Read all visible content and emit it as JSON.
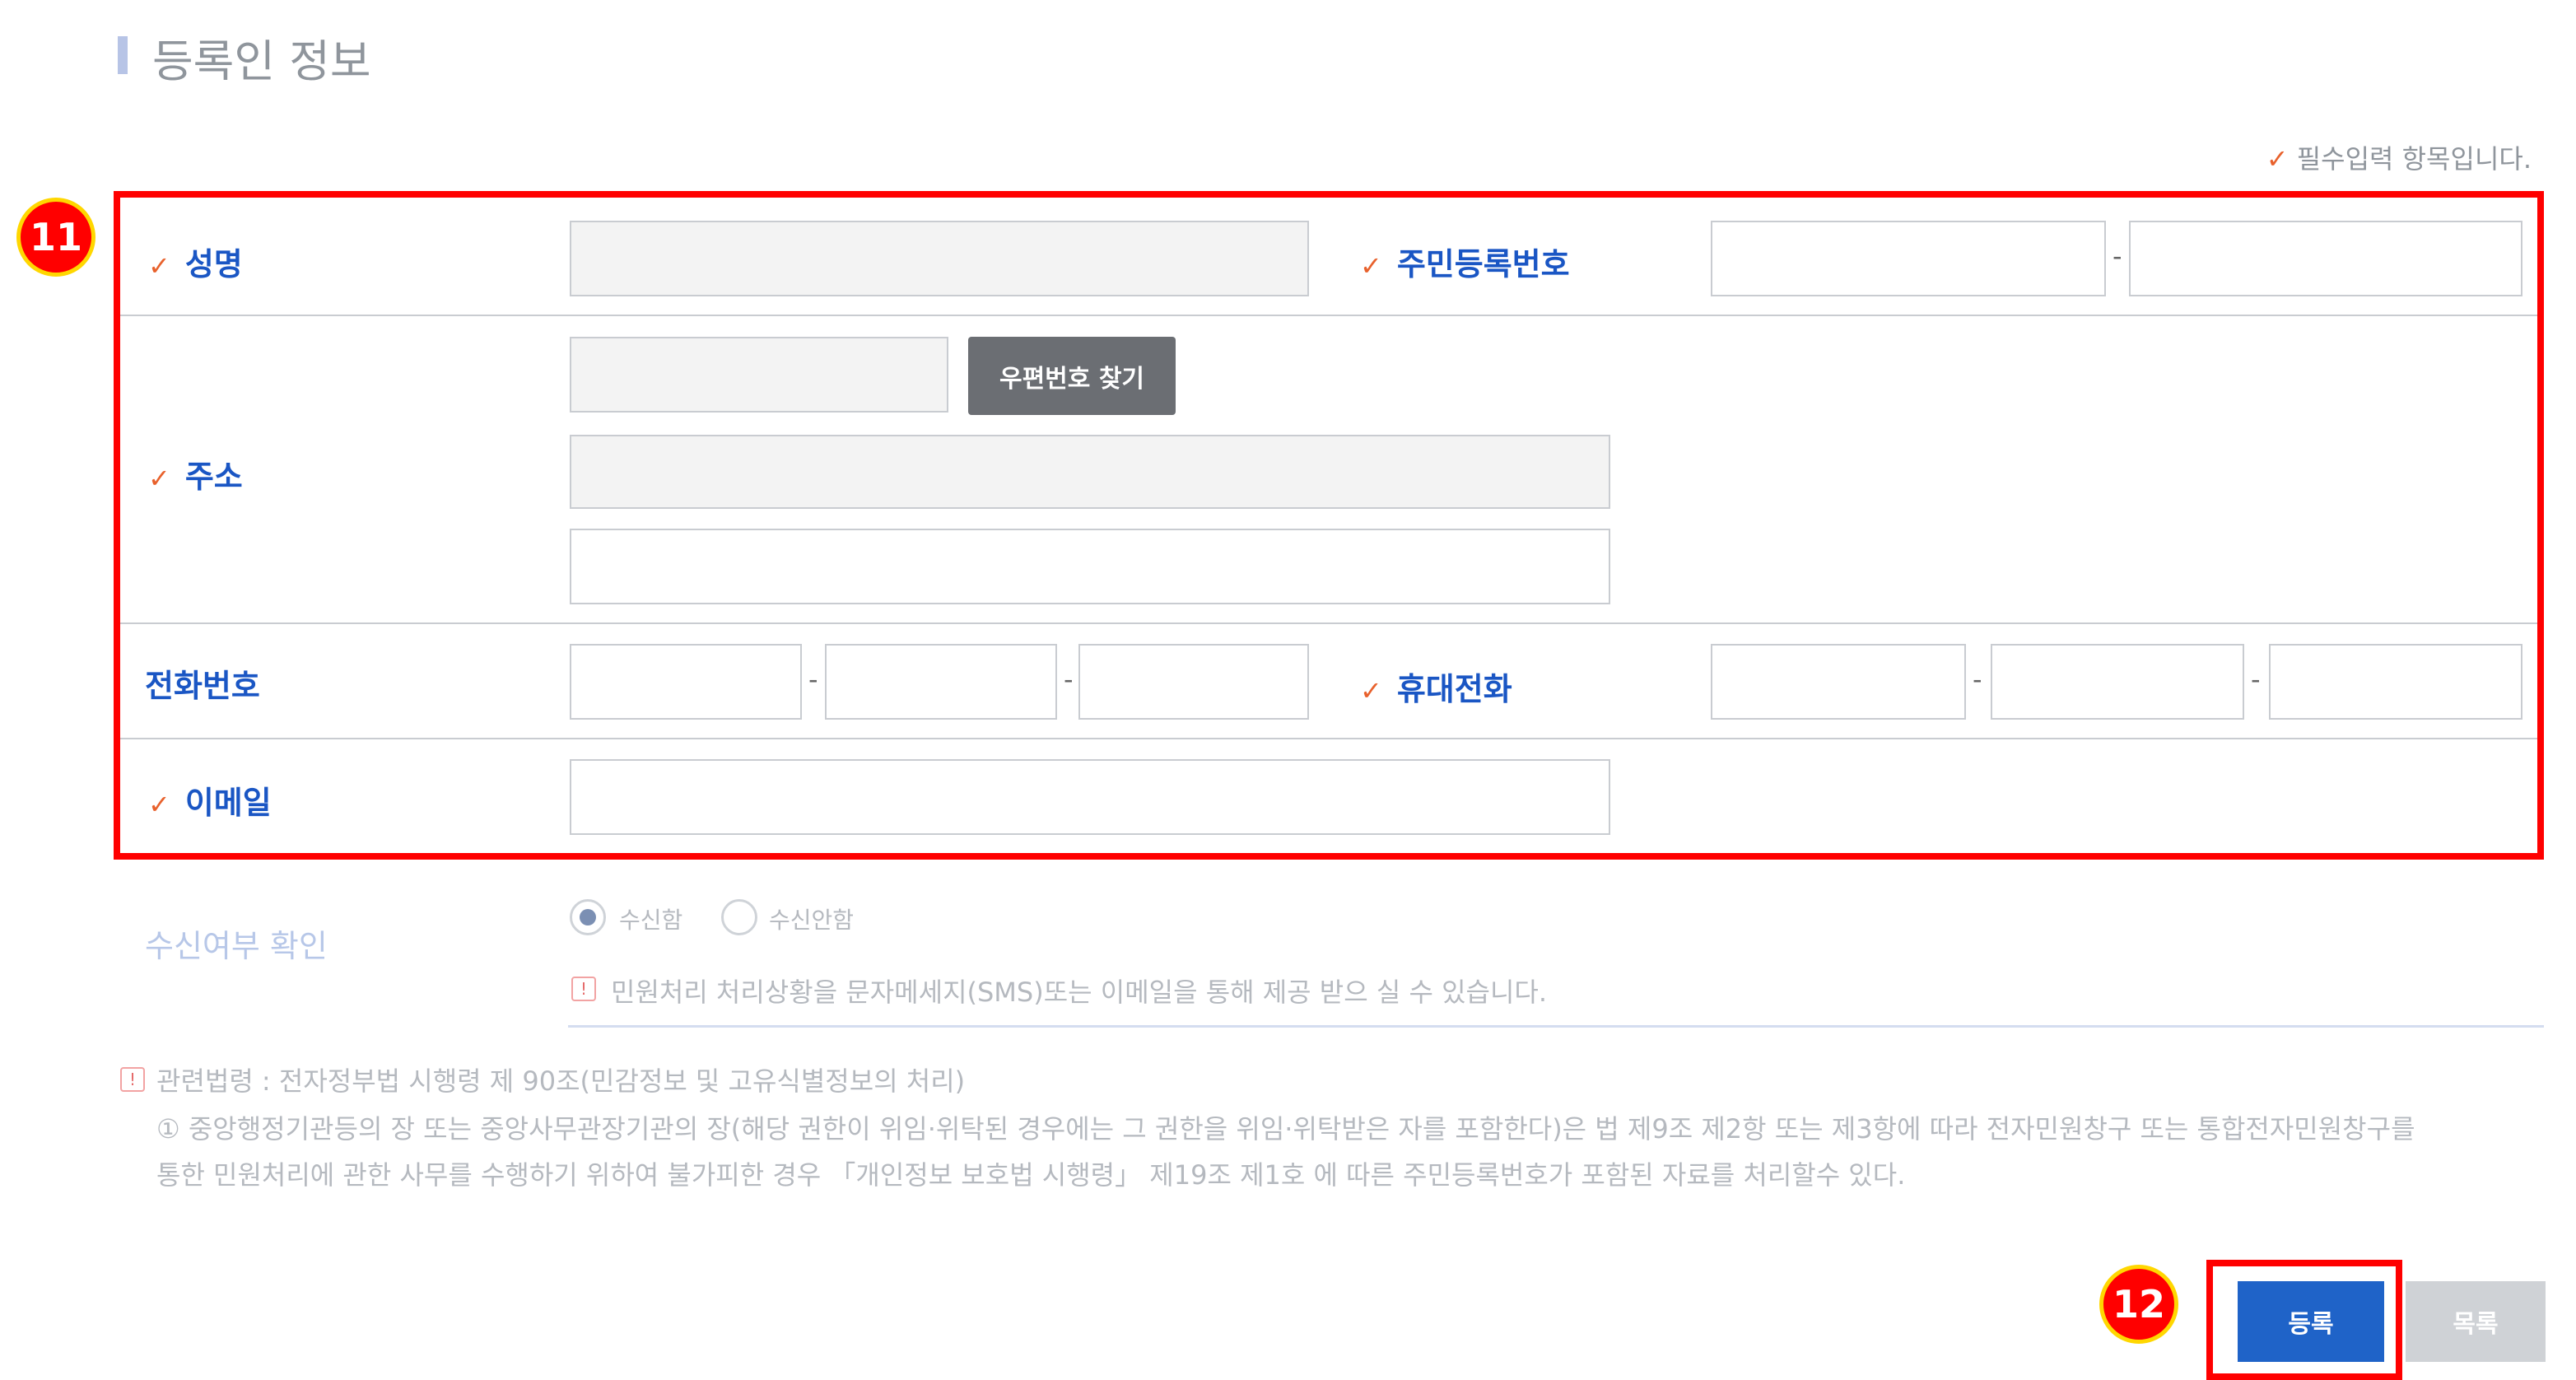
{
  "section": {
    "title": "등록인 정보"
  },
  "required_note": "필수입력 항목입니다.",
  "check_mark": "✓",
  "form": {
    "name_label": "성명",
    "resident_no_label": "주민등록번호",
    "address_label": "주소",
    "postcode_button": "우편번호 찾기",
    "phone_label": "전화번호",
    "mobile_label": "휴대전화",
    "email_label": "이메일",
    "dash": "-"
  },
  "receive": {
    "label": "수신여부 확인",
    "options": [
      "수신함",
      "수신안함"
    ],
    "selected": "수신함",
    "note": "민원처리 처리상황을 문자메세지(SMS)또는 이메일을 통해 제공 받으 실 수 있습니다."
  },
  "law": {
    "title": "관련법령 : 전자정부법 시행령 제 90조(민감정보 및 고유식별정보의 처리)",
    "line1": "① 중앙행정기관등의 장 또는 중앙사무관장기관의 장(해당 권한이 위임·위탁된 경우에는 그 권한을 위임·위탁받은 자를 포함한다)은 법 제9조 제2항 또는 제3항에 따라 전자민원창구 또는 통합전자민원창구를",
    "line2": "통한 민원처리에 관한 사무를 수행하기 위하여 불가피한 경우 「개인정보 보호법 시행령」 제19조 제1호 에 따른 주민등록번호가 포함된 자료를 처리할수 있다."
  },
  "buttons": {
    "register": "등록",
    "list": "목록"
  },
  "annotations": {
    "form_badge": "11",
    "register_badge": "12"
  },
  "warn_icon_text": "!",
  "colors": {
    "highlight": "#ff0000",
    "badge_border": "#ffd700",
    "label_blue": "#1a56c4",
    "primary_button": "#1f63c8",
    "check": "#e8612c"
  }
}
